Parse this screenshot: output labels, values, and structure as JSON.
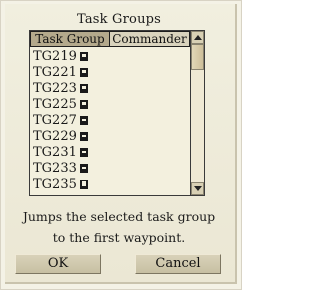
{
  "dialog": {
    "title": "Task Groups",
    "columns": {
      "task_group": "Task Group",
      "commander": "Commander"
    },
    "rows": [
      {
        "name": "TG219",
        "rank_icon": "rank-insignia-icon"
      },
      {
        "name": "TG221",
        "rank_icon": "rank-insignia-icon"
      },
      {
        "name": "TG223",
        "rank_icon": "rank-insignia-icon"
      },
      {
        "name": "TG225",
        "rank_icon": "rank-insignia-icon"
      },
      {
        "name": "TG227",
        "rank_icon": "rank-insignia-icon"
      },
      {
        "name": "TG229",
        "rank_icon": "rank-insignia-icon"
      },
      {
        "name": "TG231",
        "rank_icon": "rank-insignia-icon"
      },
      {
        "name": "TG233",
        "rank_icon": "rank-insignia-icon"
      },
      {
        "name": "TG235",
        "rank_icon": "rank-insignia-icon"
      }
    ],
    "description_line1": "Jumps the selected task group",
    "description_line2": "to the first waypoint.",
    "ok_label": "OK",
    "cancel_label": "Cancel"
  }
}
